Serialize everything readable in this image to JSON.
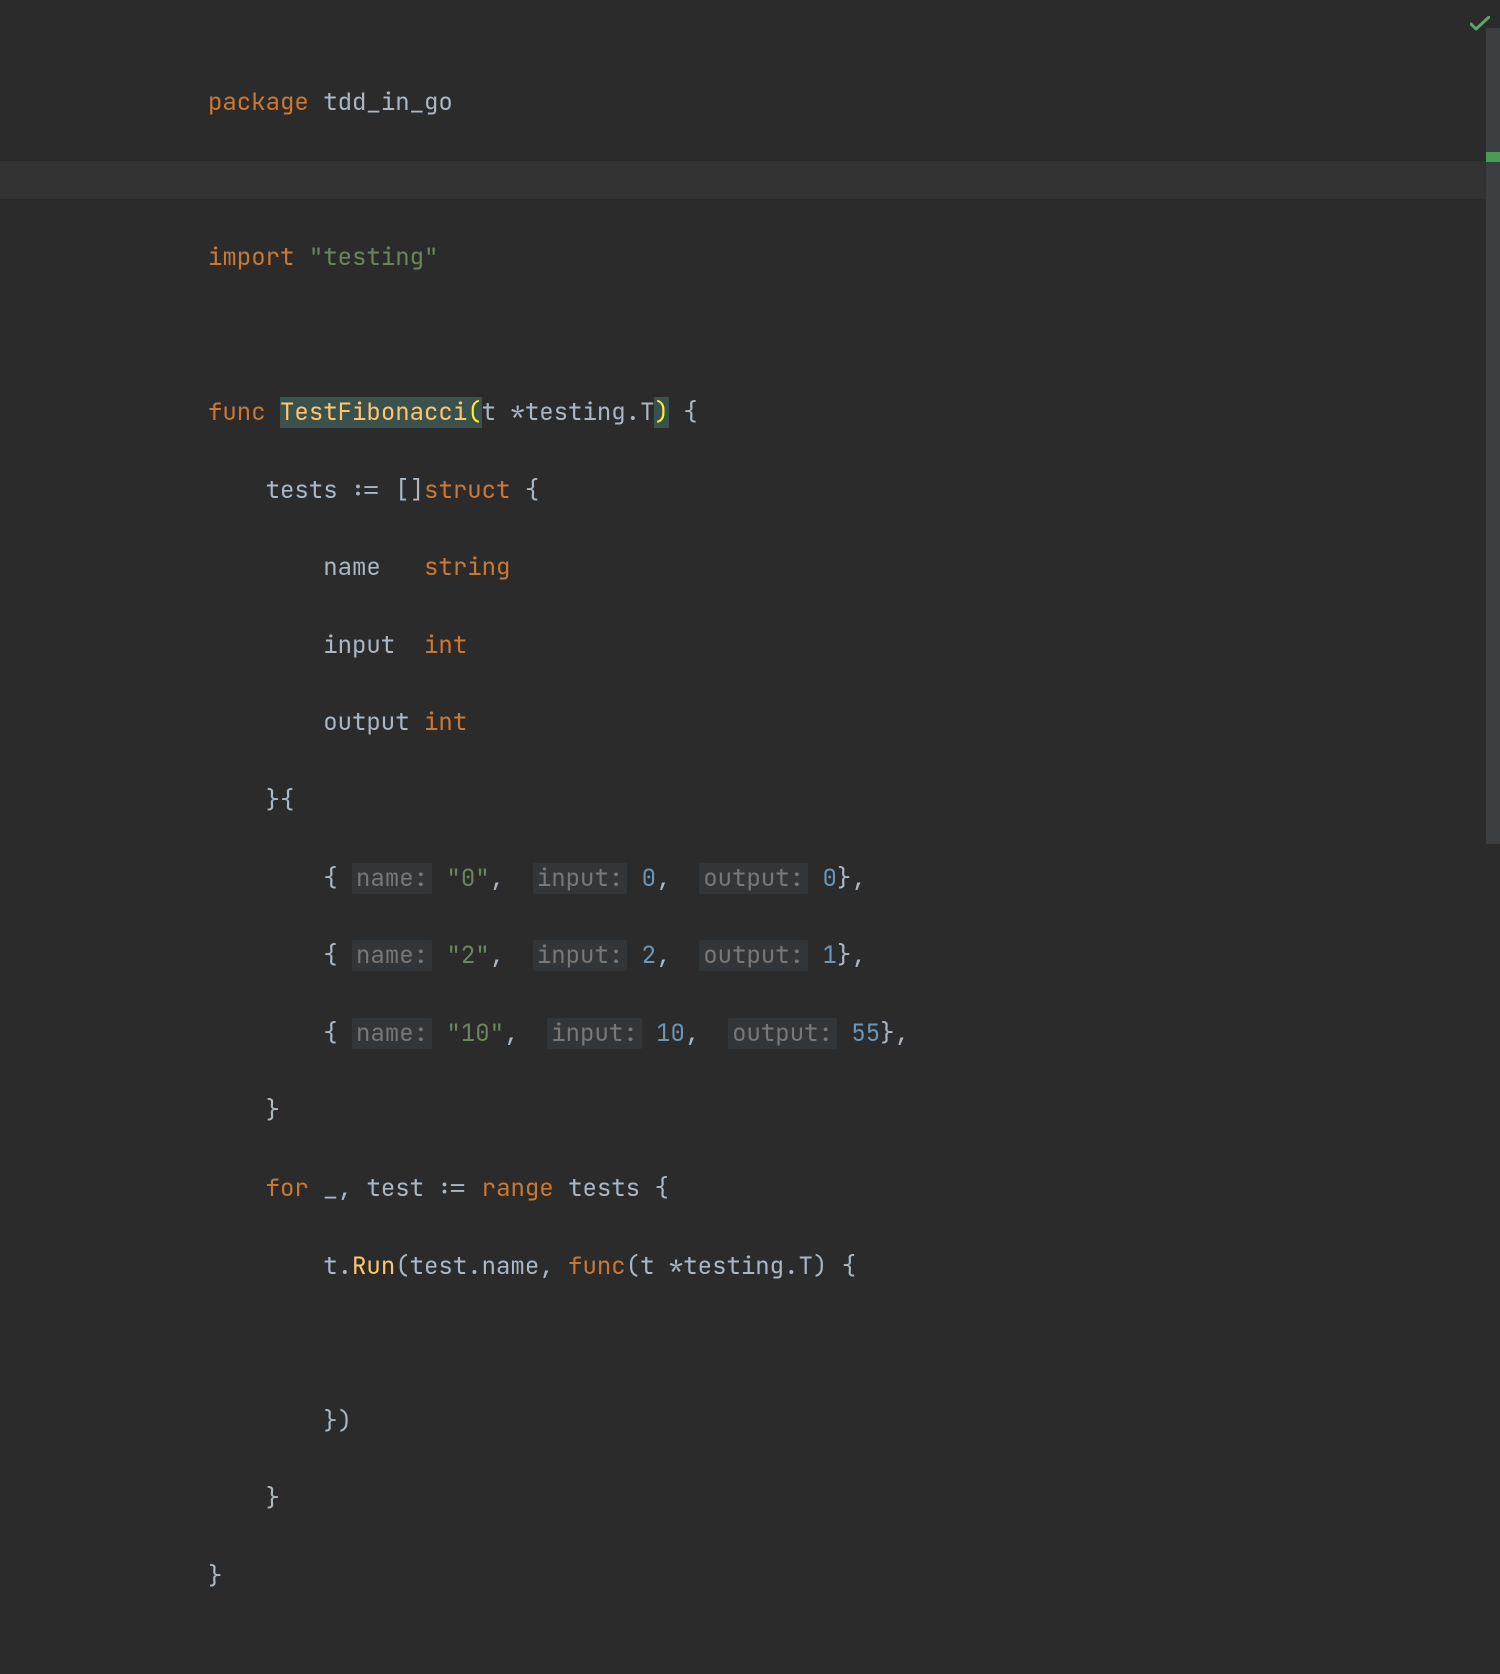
{
  "code": {
    "kw_package": "package",
    "pkg_name": "tdd_in_go",
    "kw_import": "import",
    "import_path": "\"testing\"",
    "kw_func": "func",
    "fn_name": "TestFibonacci",
    "param_t": "t",
    "star": "*",
    "testing_pkg": "testing",
    "dot": ".",
    "type_T": "T",
    "brace_open": "{",
    "brace_close": "}",
    "tests_var": "tests",
    "define": ":=",
    "sq_open": "[",
    "sq_close": "]",
    "kw_struct": "struct",
    "field_name": "name",
    "field_input": "input",
    "field_output": "output",
    "type_string": "string",
    "type_int": "int",
    "hint_name": "name:",
    "hint_input": "input:",
    "hint_output": "output:",
    "case0_name": "\"0\"",
    "case0_input": "0",
    "case0_output": "0",
    "case1_name": "\"2\"",
    "case1_input": "2",
    "case1_output": "1",
    "case2_name": "\"10\"",
    "case2_input": "10",
    "case2_output": "55",
    "kw_for": "for",
    "underscore": "_",
    "test_var": "test",
    "kw_range": "range",
    "t_var": "t",
    "run_method": "Run",
    "test_name_access": "test.name",
    "comma": ",",
    "paren_open": "(",
    "paren_close": ")"
  }
}
